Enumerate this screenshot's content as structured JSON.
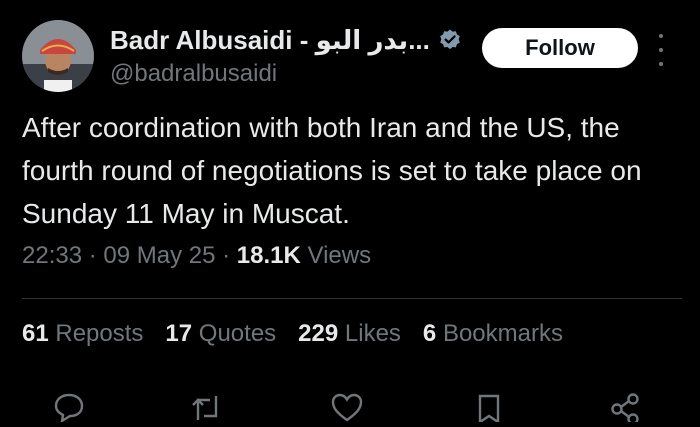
{
  "author": {
    "display_name": "Badr Albusaidi - بدر البو...",
    "handle": "@badralbusaidi",
    "verified_icon": "verified-badge-icon",
    "avatar": "avatar-photo"
  },
  "header": {
    "follow_label": "Follow",
    "more_icon": "more-options-icon"
  },
  "tweet": {
    "text": "After coordination with both Iran and the US, the fourth round of negotiations is set to take place on Sunday 11 May in Muscat."
  },
  "meta": {
    "time": "22:33",
    "separator1": " · ",
    "date": "09 May 25",
    "separator2": " · ",
    "views_count": "18.1K",
    "views_label": " Views"
  },
  "stats": {
    "reposts_count": "61",
    "reposts_label": " Reposts",
    "quotes_count": "17",
    "quotes_label": " Quotes",
    "likes_count": "229",
    "likes_label": " Likes",
    "bookmarks_count": "6",
    "bookmarks_label": " Bookmarks"
  },
  "actions": {
    "icons": [
      "reply-icon",
      "repost-icon",
      "like-icon",
      "bookmark-icon",
      "share-icon"
    ]
  },
  "colors": {
    "background": "#000000",
    "text_primary": "#e7e9ea",
    "text_secondary": "#71767b",
    "verified": "#829aab",
    "divider": "#2f3336",
    "follow_bg": "#ffffff"
  }
}
